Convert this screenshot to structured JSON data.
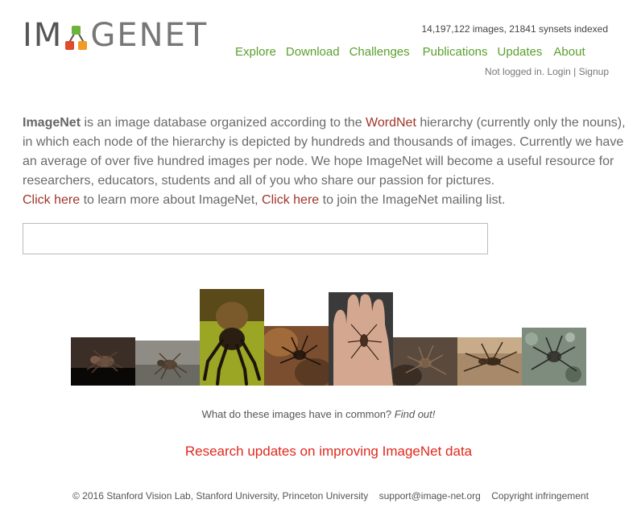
{
  "logo": {
    "part1": "IM",
    "part2": "GENET"
  },
  "header": {
    "stats": "14,197,122 images, 21841 synsets indexed",
    "nav": [
      "Explore",
      "Download",
      "Challenges",
      "Publications",
      "Updates",
      "About"
    ],
    "login_status": "Not logged in.",
    "login": "Login",
    "separator": "|",
    "signup": "Signup"
  },
  "intro": {
    "brand": "ImageNet",
    "text1": " is an image database organized according to the ",
    "wordnet_link": "WordNet",
    "text2": " hierarchy (currently only the nouns), in which each node of the hierarchy is depicted by hundreds and thousands of images. Currently we have an average of over five hundred images per node. We hope ImageNet will become a useful resource for researchers, educators, students and all of you who share our passion for pictures.",
    "click_here_1": "Click here",
    "text3": " to learn more about ImageNet, ",
    "click_here_2": "Click here",
    "text4": " to join the ImageNet mailing list."
  },
  "search": {
    "value": "",
    "placeholder": ""
  },
  "gallery": {
    "images": [
      {
        "name": "spider-photo-1",
        "bg": "#5a4a3a"
      },
      {
        "name": "spider-photo-2",
        "bg": "#8a8a80"
      },
      {
        "name": "spider-photo-3",
        "bg": "#8a9a22"
      },
      {
        "name": "spider-photo-4",
        "bg": "#7a4e2e"
      },
      {
        "name": "spider-photo-5",
        "bg": "#c89a82"
      },
      {
        "name": "spider-photo-6",
        "bg": "#6a5a4a"
      },
      {
        "name": "spider-photo-7",
        "bg": "#a88a6a"
      },
      {
        "name": "spider-photo-8",
        "bg": "#7a8a7a"
      }
    ],
    "caption_question": "What do these images have in common?",
    "caption_link": "Find out!"
  },
  "research_link": "Research updates on improving ImageNet data",
  "footer": {
    "copyright": "© 2016 Stanford Vision Lab, Stanford University, Princeton University",
    "email": "support@image-net.org",
    "infringement": "Copyright infringement"
  },
  "colors": {
    "nav_green": "#5aa02c",
    "link_red": "#a0352b",
    "research_red": "#e0281e",
    "logo_green": "#6ab33c",
    "logo_red": "#e14a2c",
    "logo_orange": "#f29b24"
  }
}
